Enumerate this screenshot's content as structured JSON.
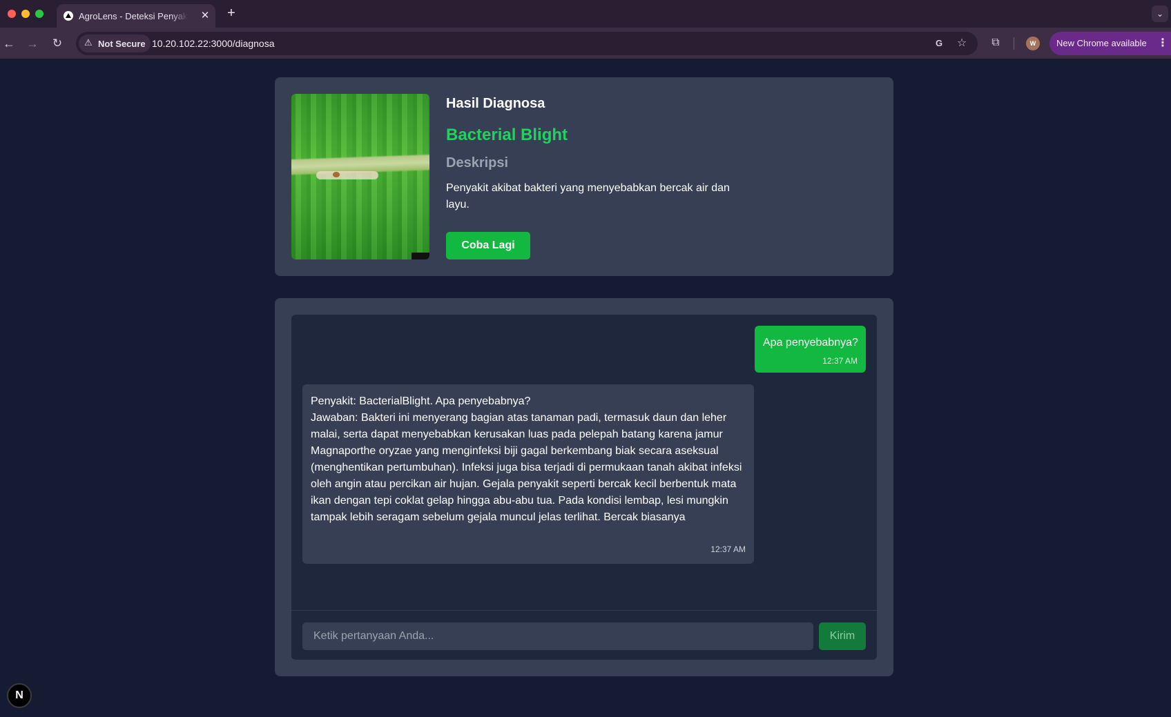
{
  "browser": {
    "tab_title": "AgroLens - Deteksi Penyakit Tanaman",
    "tab_close": "✕",
    "new_tab": "+",
    "tab_list": "⌄",
    "security_label": "Not Secure",
    "url": "10.20.102.22:3000/diagnosa",
    "profile_initial": "W",
    "update_label": "New Chrome available",
    "icons": {
      "back": "arrow-left-icon",
      "forward": "arrow-right-icon",
      "reload": "reload-icon",
      "warning": "warning-icon",
      "translate": "translate-icon",
      "bookmark": "star-icon",
      "extensions": "puzzle-icon",
      "menu": "kebab-icon"
    }
  },
  "result": {
    "heading": "Hasil Diagnosa",
    "disease_name": "Bacterial Blight",
    "description_heading": "Deskripsi",
    "description": "Penyakit akibat bakteri yang menyebabkan bercak air dan layu.",
    "retry_label": "Coba Lagi",
    "accent_color": "#22d15f"
  },
  "chat": {
    "messages": [
      {
        "role": "user",
        "text": "Apa penyebabnya?",
        "time": "12:37 AM"
      },
      {
        "role": "bot",
        "text": "Penyakit: BacterialBlight. Apa penyebabnya?\nJawaban: Bakteri ini menyerang bagian atas tanaman padi, termasuk daun dan leher malai, serta dapat menyebabkan kerusakan luas pada pelepah batang karena jamur Magnaporthe oryzae yang menginfeksi biji gagal berkembang biak secara aseksual (menghentikan pertumbuhan). Infeksi juga bisa terjadi di permukaan tanah akibat infeksi oleh angin atau percikan air hujan. Gejala penyakit seperti bercak kecil berbentuk mata ikan dengan tepi coklat gelap hingga abu-abu tua. Pada kondisi lembap, lesi mungkin tampak lebih seragam sebelum gejala muncul jelas terlihat. Bercak biasanya",
        "time": "12:37 AM"
      }
    ],
    "input_placeholder": "Ketik pertanyaan Anda...",
    "input_value": "",
    "send_label": "Kirim"
  },
  "dev_badge": "N"
}
